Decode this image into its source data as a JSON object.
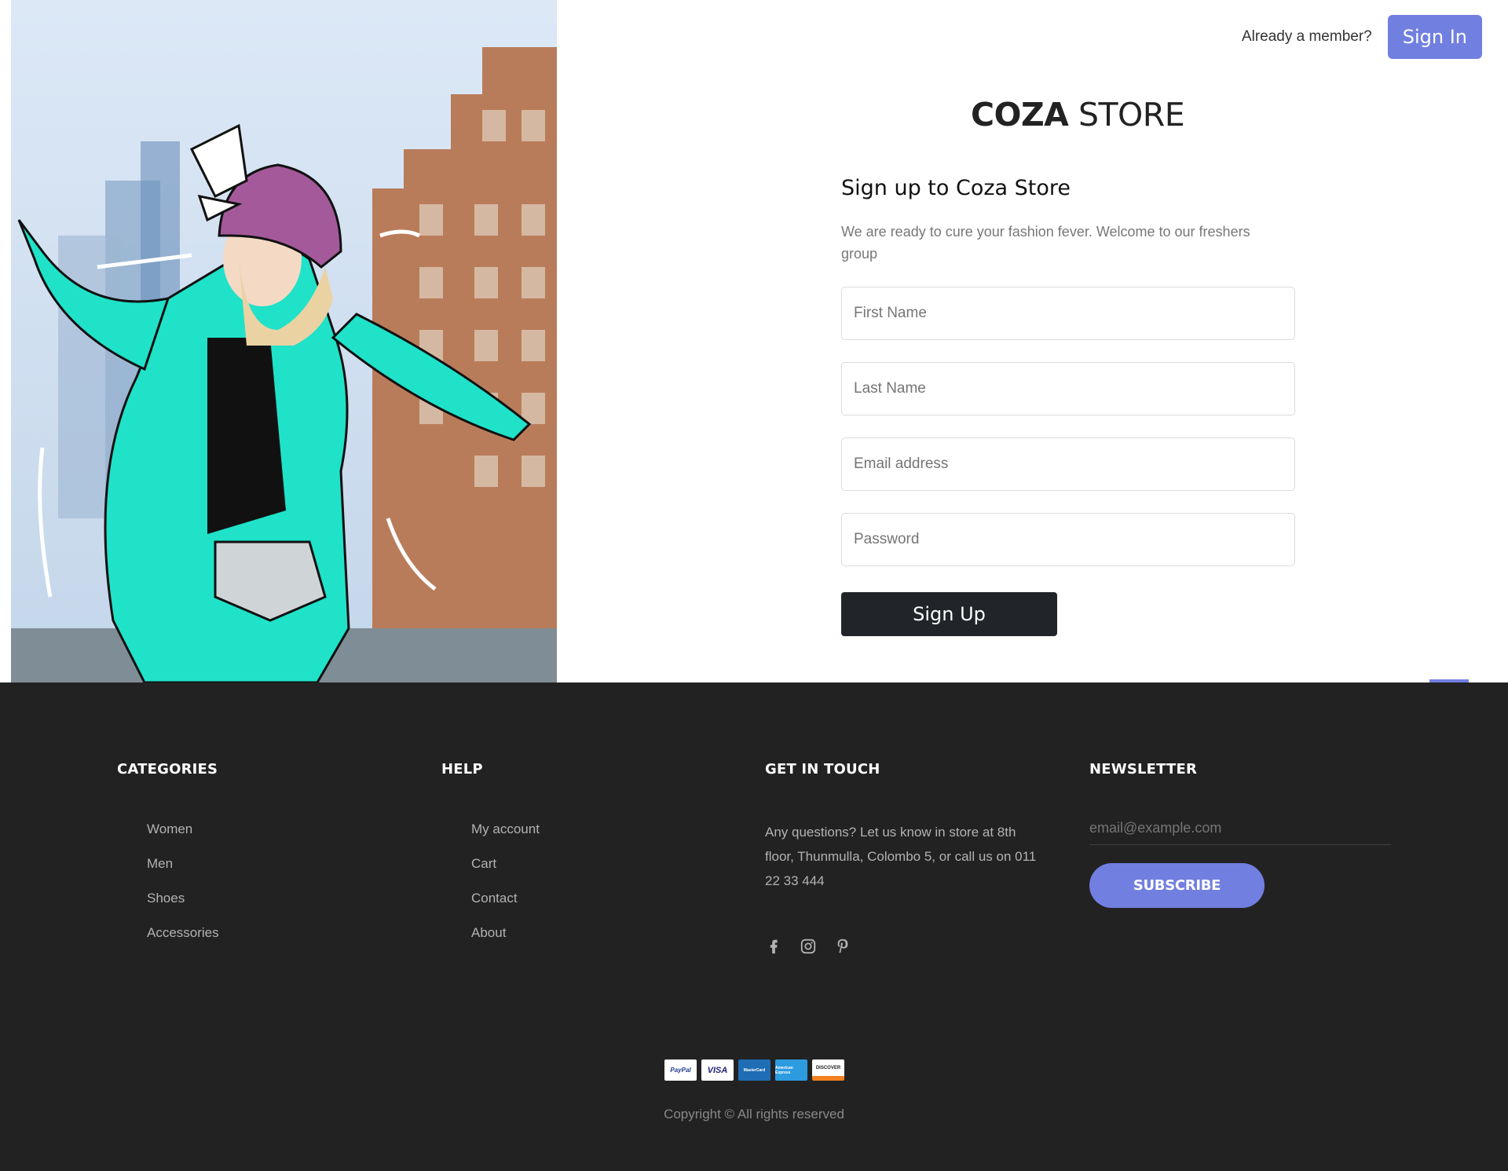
{
  "header": {
    "member_text": "Already a member?",
    "signin_label": "Sign In",
    "accent": "#717fe0"
  },
  "brand": {
    "bold": "COZA",
    "light": "STORE"
  },
  "form": {
    "title": "Sign up to Coza Store",
    "subtitle": "We are ready to cure your fashion fever. Welcome to our freshers group",
    "fields": [
      {
        "placeholder": "First Name"
      },
      {
        "placeholder": "Last Name"
      },
      {
        "placeholder": "Email address"
      },
      {
        "placeholder": "Password"
      }
    ],
    "submit_label": "Sign Up"
  },
  "footer": {
    "background": "#222222",
    "categories": {
      "title": "CATEGORIES",
      "items": [
        "Women",
        "Men",
        "Shoes",
        "Accessories"
      ]
    },
    "help": {
      "title": "HELP",
      "items": [
        "My account",
        "Cart",
        "Contact",
        "About"
      ]
    },
    "touch": {
      "title": "GET IN TOUCH",
      "text": "Any questions? Let us know in store at 8th floor, Thunmulla, Colombo 5, or call us on 011 22 33 444",
      "social": [
        "facebook-icon",
        "instagram-icon",
        "pinterest-icon"
      ]
    },
    "newsletter": {
      "title": "NEWSLETTER",
      "placeholder": "email@example.com",
      "button": "SUBSCRIBE"
    },
    "payments": [
      "PayPal",
      "VISA",
      "MasterCard",
      "American Express",
      "DISCOVER"
    ],
    "copyright": "Copyright © All rights reserved"
  }
}
